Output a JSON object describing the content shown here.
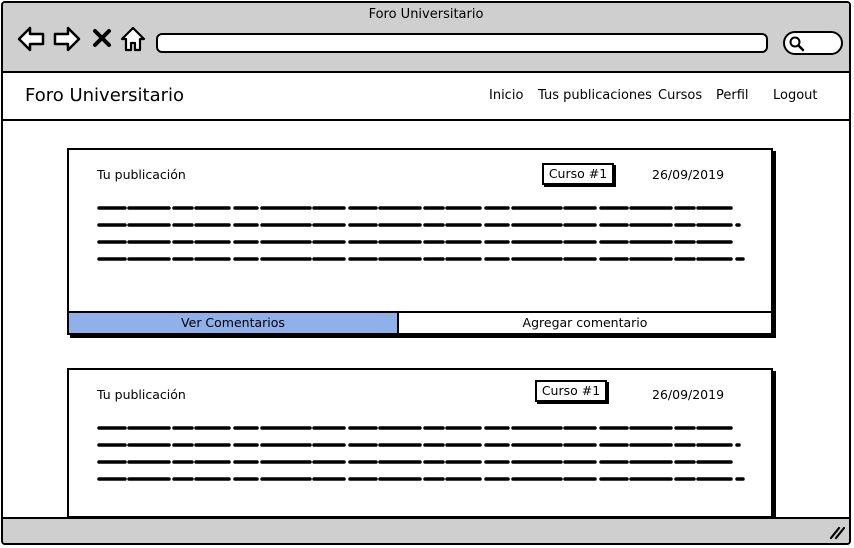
{
  "browser": {
    "window_title": "Foro Universitario",
    "url": "",
    "buttons": {
      "back": "back-arrow-icon",
      "forward": "forward-arrow-icon",
      "stop": "close-icon",
      "home": "home-icon",
      "search": "search-icon"
    }
  },
  "header": {
    "brand": "Foro Universitario",
    "nav": [
      "Inicio",
      "Tus publicaciones",
      "Cursos",
      "Perfil",
      "Logout"
    ]
  },
  "posts": [
    {
      "title": "Tu publicación",
      "course": "Curso #1",
      "date": "26/09/2019",
      "actions": {
        "view_comments": "Ver Comentarios",
        "add_comment": "Agregar comentario"
      }
    },
    {
      "title": "Tu publicación",
      "course": "Curso #1",
      "date": "26/09/2019"
    }
  ],
  "colors": {
    "chrome": "#cfcfcf",
    "primary_action": "#8fb0e8"
  }
}
